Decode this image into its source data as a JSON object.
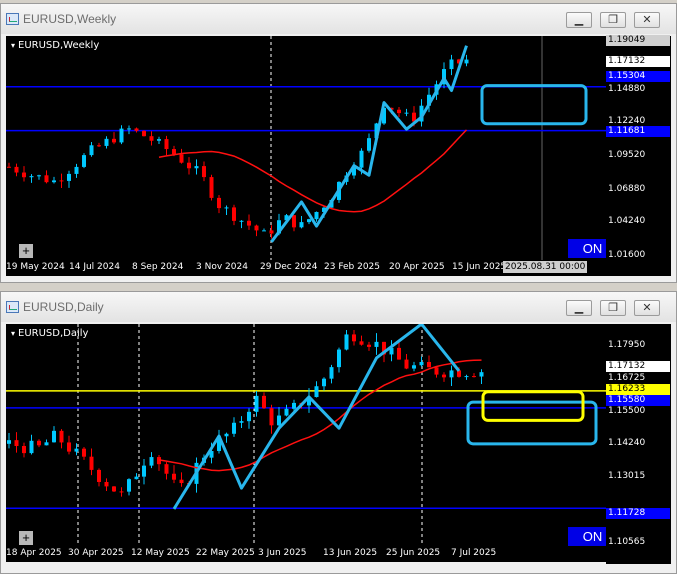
{
  "weekly": {
    "window_title": "EURUSD,Weekly",
    "chart_label": "EURUSD,Weekly",
    "on_label": "ON",
    "plus_label": "+",
    "time_labels": [
      "19 May 2024",
      "14 Jul 2024",
      "8 Sep 2024",
      "3 Nov 2024",
      "29 Dec 2024",
      "23 Feb 2025",
      "20 Apr 2025",
      "15 Jun 2025"
    ],
    "cursor_time": "2025.08.31 00:00",
    "price_labels": [
      "1.14880",
      "1.12240",
      "1.09520",
      "1.06880",
      "1.04240",
      "1.01600"
    ],
    "price_tags": {
      "top": "1.19049",
      "bid": "1.17132",
      "line1": "1.15304",
      "line2": "1.11681"
    }
  },
  "daily": {
    "window_title": "EURUSD,Daily",
    "chart_label": "EURUSD,Daily",
    "on_label": "ON",
    "plus_label": "+",
    "time_labels": [
      "18 Apr 2025",
      "30 Apr 2025",
      "12 May 2025",
      "22 May 2025",
      "3 Jun 2025",
      "13 Jun 2025",
      "25 Jun 2025",
      "7 Jul 2025"
    ],
    "price_labels": [
      "1.17950",
      "1.16725",
      "1.15500",
      "1.14240",
      "1.13015",
      "1.11790",
      "1.10565"
    ],
    "price_tags": {
      "bid": "1.17132",
      "yellow": "1.16233",
      "blue": "1.15580",
      "low": "1.11728"
    }
  },
  "colors": {
    "bull": "#00c8ff",
    "bear": "#ff0000",
    "ma": "#ff1010",
    "hline": "#0000ff",
    "yellow": "#ffff00",
    "bg": "#000000"
  },
  "icons": {
    "minimize": "minimize-icon",
    "restore": "restore-icon",
    "close": "close-icon"
  },
  "chart_data": [
    {
      "type": "candlestick",
      "title": "EURUSD,Weekly",
      "ylim": [
        1.01,
        1.195
      ],
      "hlines": [
        1.15304,
        1.11681
      ],
      "annotations": [
        "zigzag (cyan)",
        "moving average (red)",
        "target box (cyan)"
      ]
    },
    {
      "type": "candlestick",
      "title": "EURUSD,Daily",
      "ylim": [
        1.102,
        1.188
      ],
      "hlines": [
        1.16233,
        1.1558,
        1.11728
      ],
      "annotations": [
        "zigzag (cyan)",
        "moving average (red)",
        "target boxes (cyan, yellow)"
      ]
    }
  ]
}
